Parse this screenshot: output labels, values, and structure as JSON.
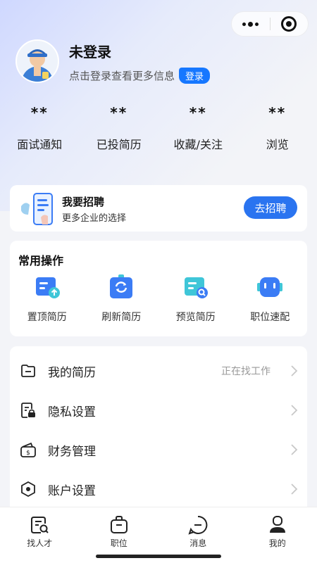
{
  "profile": {
    "name": "未登录",
    "tip": "点击登录查看更多信息",
    "login_label": "登录"
  },
  "stats": [
    {
      "value": "**",
      "label": "面试通知"
    },
    {
      "value": "**",
      "label": "已投简历"
    },
    {
      "value": "**",
      "label": "收藏/关注"
    },
    {
      "value": "**",
      "label": "浏览"
    }
  ],
  "recruit": {
    "title": "我要招聘",
    "subtitle": "更多企业的选择",
    "button": "去招聘"
  },
  "ops": {
    "title": "常用操作",
    "items": [
      {
        "label": "置顶简历",
        "icon": "resume-top-icon"
      },
      {
        "label": "刷新简历",
        "icon": "refresh-resume-icon"
      },
      {
        "label": "预览简历",
        "icon": "preview-resume-icon"
      },
      {
        "label": "职位速配",
        "icon": "job-match-robot-icon"
      }
    ]
  },
  "menu": [
    {
      "label": "我的简历",
      "extra": "正在找工作",
      "icon": "folder-icon"
    },
    {
      "label": "隐私设置",
      "extra": "",
      "icon": "privacy-lock-icon"
    },
    {
      "label": "财务管理",
      "extra": "",
      "icon": "wallet-icon"
    },
    {
      "label": "账户设置",
      "extra": "",
      "icon": "settings-hex-icon"
    }
  ],
  "tabs": [
    {
      "label": "找人才",
      "icon": "find-talent-icon"
    },
    {
      "label": "职位",
      "icon": "briefcase-icon"
    },
    {
      "label": "消息",
      "icon": "message-icon"
    },
    {
      "label": "我的",
      "icon": "user-icon"
    }
  ],
  "colors": {
    "accent": "#1677ff",
    "button_blue": "#2a74f0",
    "icon_blue": "#3b7cf5",
    "icon_teal": "#3fc6d8"
  }
}
